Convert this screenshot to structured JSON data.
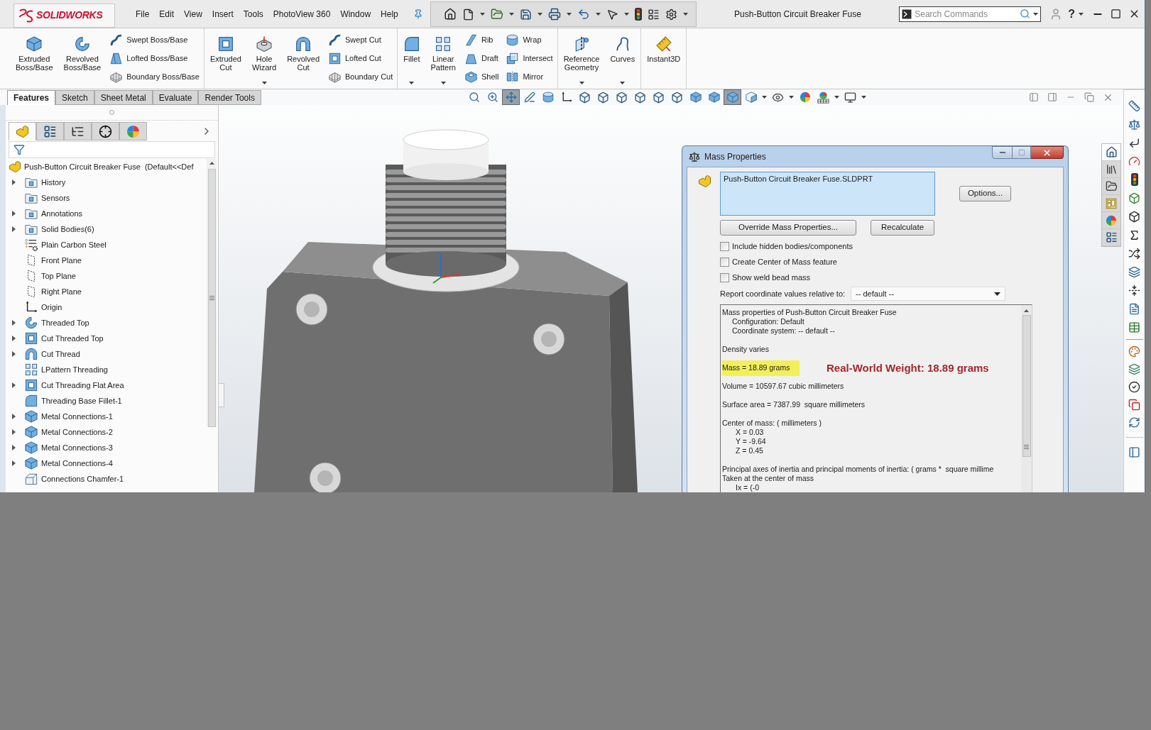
{
  "title_bar": {
    "logo": "SOLIDWORKS",
    "menu": [
      "File",
      "Edit",
      "View",
      "Insert",
      "Tools",
      "PhotoView 360",
      "Window",
      "Help"
    ],
    "document_title": "Push-Button Circuit Breaker Fuse",
    "search": {
      "placeholder": "Search Commands"
    },
    "help": "?"
  },
  "ribbon": [
    {
      "items": [
        {
          "kind": "extrude",
          "label": "Extruded Boss/Base",
          "dropdown": false
        },
        {
          "kind": "revolve",
          "label": "Revolved Boss/Base",
          "dropdown": false
        },
        {
          "stack": [
            {
              "kind": "sweep",
              "label": "Swept Boss/Base"
            },
            {
              "kind": "loft",
              "label": "Lofted Boss/Base"
            },
            {
              "kind": "boundary",
              "label": "Boundary Boss/Base"
            }
          ]
        }
      ]
    },
    {
      "items": [
        {
          "kind": "extrudecut",
          "label": "Extruded Cut",
          "dropdown": false
        },
        {
          "kind": "hole",
          "label": "Hole Wizard",
          "dropdown": true
        },
        {
          "kind": "revolvecut",
          "label": "Revolved Cut",
          "dropdown": false
        },
        {
          "stack": [
            {
              "kind": "sweptcut",
              "label": "Swept Cut"
            },
            {
              "kind": "loftcut",
              "label": "Lofted Cut"
            },
            {
              "kind": "boundarycut",
              "label": "Boundary Cut"
            }
          ]
        }
      ]
    },
    {
      "items": [
        {
          "kind": "fillet",
          "label": "Fillet",
          "dropdown": true
        },
        {
          "kind": "pattern",
          "label": "Linear Pattern",
          "dropdown": true
        },
        {
          "stack": [
            {
              "kind": "rib",
              "label": "Rib"
            },
            {
              "kind": "draft",
              "label": "Draft"
            },
            {
              "kind": "shell",
              "label": "Shell"
            }
          ]
        },
        {
          "stack": [
            {
              "kind": "wrap",
              "label": "Wrap"
            },
            {
              "kind": "intersect",
              "label": "Intersect"
            },
            {
              "kind": "mirror",
              "label": "Mirror"
            }
          ]
        }
      ]
    },
    {
      "items": [
        {
          "kind": "refgeom",
          "label": "Reference Geometry",
          "dropdown": true
        },
        {
          "kind": "curves",
          "label": "Curves",
          "dropdown": true
        }
      ]
    },
    {
      "items": [
        {
          "kind": "instant3d",
          "label": "Instant3D",
          "dropdown": false
        }
      ]
    }
  ],
  "command_tabs": [
    {
      "label": "Features",
      "selected": true
    },
    {
      "label": "Sketch",
      "selected": false
    },
    {
      "label": "Sheet Metal",
      "selected": false
    },
    {
      "label": "Evaluate",
      "selected": false
    },
    {
      "label": "Render Tools",
      "selected": false
    }
  ],
  "view_toolbar": [
    {
      "kind": "zoomfit",
      "selected": false,
      "dropdown": false
    },
    {
      "kind": "zoomarea",
      "selected": false,
      "dropdown": false
    },
    {
      "kind": "pan",
      "selected": true,
      "dropdown": false
    },
    {
      "kind": "pencil",
      "selected": false,
      "dropdown": false
    },
    {
      "kind": "section",
      "selected": false,
      "dropdown": false
    },
    {
      "kind": "triad",
      "selected": false,
      "dropdown": false
    },
    {
      "kind": "view",
      "selected": false,
      "dropdown": false
    },
    {
      "kind": "view",
      "selected": false,
      "dropdown": false
    },
    {
      "kind": "view",
      "selected": false,
      "dropdown": false
    },
    {
      "kind": "view",
      "selected": false,
      "dropdown": false
    },
    {
      "kind": "view",
      "selected": false,
      "dropdown": false
    },
    {
      "kind": "view",
      "selected": false,
      "dropdown": false
    },
    {
      "kind": "shaded",
      "selected": false,
      "dropdown": false
    },
    {
      "kind": "shaded",
      "selected": false,
      "dropdown": false
    },
    {
      "kind": "shaded",
      "selected": true,
      "dropdown": false
    },
    {
      "kind": "hidden",
      "selected": false,
      "dropdown": true
    },
    {
      "kind": "hide",
      "selected": false,
      "dropdown": true
    },
    {
      "kind": "appearance",
      "selected": false,
      "dropdown": false
    },
    {
      "kind": "scene",
      "selected": false,
      "dropdown": true
    },
    {
      "kind": "display",
      "selected": false,
      "dropdown": true
    }
  ],
  "feature_manager": {
    "tabs": [
      {
        "kind": "tree",
        "selected": true
      },
      {
        "kind": "properties",
        "selected": false
      },
      {
        "kind": "configurations",
        "selected": false
      },
      {
        "kind": "dimxpert",
        "selected": false
      },
      {
        "kind": "display",
        "selected": false
      }
    ],
    "root": "Push-Button Circuit Breaker Fuse  (Default<<Def",
    "items": [
      {
        "kind": "history",
        "label": "History",
        "expandable": true
      },
      {
        "kind": "sensors",
        "label": "Sensors",
        "expandable": false
      },
      {
        "kind": "annotations",
        "label": "Annotations",
        "expandable": true
      },
      {
        "kind": "bodies",
        "label": "Solid Bodies(6)",
        "expandable": true
      },
      {
        "kind": "material",
        "label": "Plain Carbon Steel",
        "expandable": false
      },
      {
        "kind": "plane",
        "label": "Front Plane",
        "expandable": false
      },
      {
        "kind": "plane",
        "label": "Top Plane",
        "expandable": false
      },
      {
        "kind": "plane",
        "label": "Right Plane",
        "expandable": false
      },
      {
        "kind": "origin",
        "label": "Origin",
        "expandable": false
      },
      {
        "kind": "revolve",
        "label": "Threaded Top",
        "expandable": true
      },
      {
        "kind": "cut",
        "label": "Cut Threaded Top",
        "expandable": true
      },
      {
        "kind": "cutrevolve",
        "label": "Cut Thread",
        "expandable": true
      },
      {
        "kind": "pattern",
        "label": "LPattern Threading",
        "expandable": false
      },
      {
        "kind": "cut",
        "label": "Cut Threading Flat Area",
        "expandable": true
      },
      {
        "kind": "fillet",
        "label": "Threading Base Fillet-1",
        "expandable": false
      },
      {
        "kind": "extrude",
        "label": "Metal Connections-1",
        "expandable": true
      },
      {
        "kind": "extrude",
        "label": "Metal Connections-2",
        "expandable": true
      },
      {
        "kind": "extrude",
        "label": "Metal Connections-3",
        "expandable": true
      },
      {
        "kind": "extrude",
        "label": "Metal Connections-4",
        "expandable": true
      },
      {
        "kind": "chamfer",
        "label": "Connections Chamfer-1",
        "expandable": false
      }
    ]
  },
  "task_pane_tabs": [
    {
      "kind": "home",
      "selected": true
    },
    {
      "kind": "library",
      "selected": false
    },
    {
      "kind": "files",
      "selected": false
    },
    {
      "kind": "palette",
      "selected": false
    },
    {
      "kind": "appearances",
      "selected": false
    },
    {
      "kind": "properties",
      "selected": false
    }
  ],
  "mass_properties": {
    "title": "Mass Properties",
    "selection": "Push-Button Circuit Breaker Fuse.SLDPRT",
    "options_button": "Options...",
    "override_button": "Override Mass Properties...",
    "recalculate_button": "Recalculate",
    "checkboxes": [
      {
        "label": "Include hidden bodies/components",
        "checked": false
      },
      {
        "label": "Create Center of Mass feature",
        "checked": false
      },
      {
        "label": "Show weld bead mass",
        "checked": false
      }
    ],
    "coordinate_label": "Report coordinate values relative to:",
    "coordinate_value": "-- default --",
    "results": [
      {
        "lines": [
          {
            "kind": "plain",
            "text": "Mass properties of Push-Button Circuit Breaker Fuse"
          },
          {
            "kind": "sub",
            "text": "Configuration: Default"
          },
          {
            "kind": "sub",
            "text": "Coordinate system: -- default --"
          }
        ]
      },
      {
        "lines": [
          {
            "kind": "plain",
            "text": "Density varies"
          }
        ]
      },
      {
        "lines": [
          {
            "kind": "highlight",
            "text": "Mass = 18.89 grams",
            "note": "Real-World Weight: 18.89 grams"
          }
        ]
      },
      {
        "lines": [
          {
            "kind": "plain",
            "text": "Volume = 10597.67 cubic millimeters"
          }
        ]
      },
      {
        "lines": [
          {
            "kind": "plain",
            "text": "Surface area = 7387.99  square millimeters"
          }
        ]
      },
      {
        "lines": [
          {
            "kind": "plain",
            "text": "Center of mass: ( millimeters )"
          },
          {
            "kind": "value",
            "text": "X = 0.03"
          },
          {
            "kind": "value",
            "text": "Y = -9.64"
          },
          {
            "kind": "value",
            "text": "Z = 0.45"
          }
        ]
      },
      {
        "lines": [
          {
            "kind": "plain",
            "text": "Principal axes of inertia and principal moments of inertia: ( grams *  square millime"
          },
          {
            "kind": "plain",
            "text": "Taken at the center of mass"
          },
          {
            "kind": "value",
            "text": "Ix = (-0"
          }
        ]
      }
    ]
  }
}
